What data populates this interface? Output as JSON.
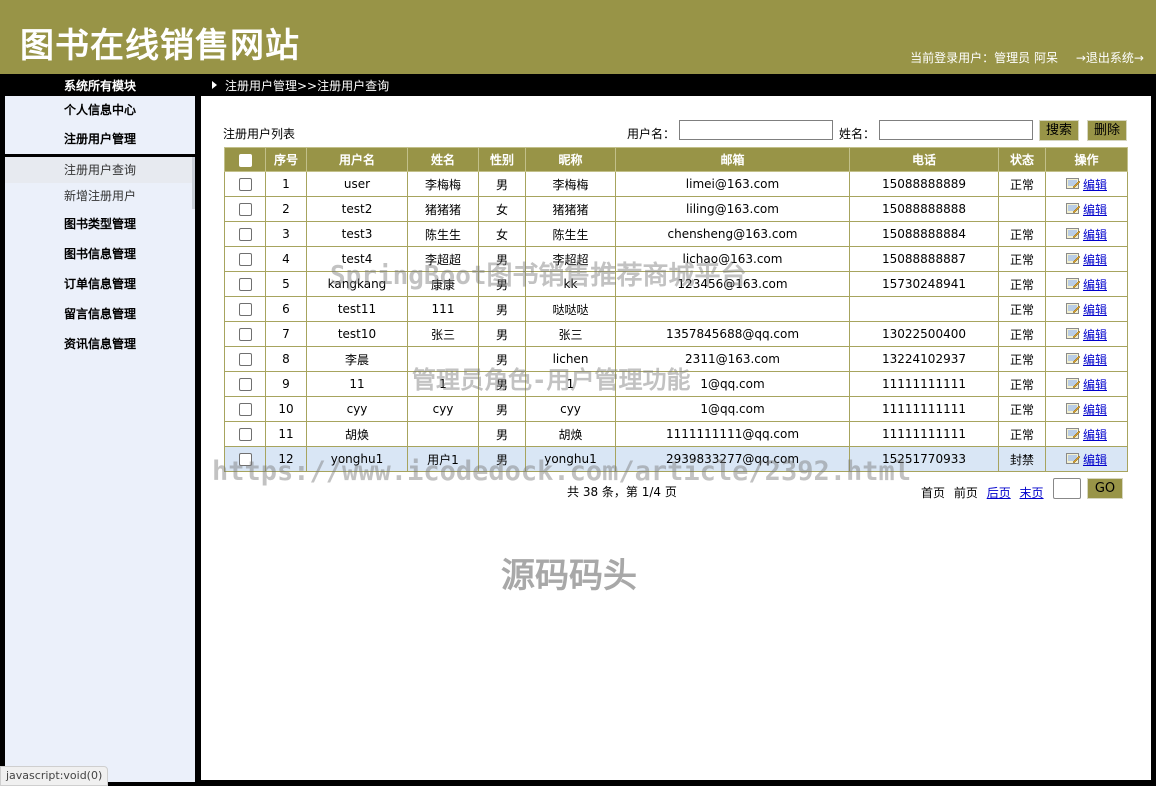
{
  "header": {
    "site_title": "图书在线销售网站",
    "user_info": "当前登录用户：管理员 阿呆",
    "logout": "→退出系统→"
  },
  "strip": {
    "module_title": "系统所有模块",
    "breadcrumb": "注册用户管理>>注册用户查询"
  },
  "sidebar": {
    "personal_center": "个人信息中心",
    "user_mgmt": "注册用户管理",
    "sub_items": [
      "注册用户查询",
      "新增注册用户"
    ],
    "others": [
      "图书类型管理",
      "图书信息管理",
      "订单信息管理",
      "留言信息管理",
      "资讯信息管理"
    ]
  },
  "toolbar": {
    "list_title": "注册用户列表",
    "username_label": "用户名：",
    "username_value": "",
    "name_label": "姓名：",
    "name_value": "",
    "search_label": "搜索",
    "delete_label": "删除"
  },
  "table": {
    "columns": [
      "序号",
      "用户名",
      "姓名",
      "性别",
      "昵称",
      "邮箱",
      "电话",
      "状态",
      "操作"
    ],
    "edit_label": "编辑",
    "rows": [
      {
        "no": "1",
        "username": "user",
        "name": "李梅梅",
        "gender": "男",
        "nickname": "李梅梅",
        "email": "limei@163.com",
        "phone": "15088888889",
        "status": "正常"
      },
      {
        "no": "2",
        "username": "test2",
        "name": "猪猪猪",
        "gender": "女",
        "nickname": "猪猪猪",
        "email": "liling@163.com",
        "phone": "15088888888",
        "status": ""
      },
      {
        "no": "3",
        "username": "test3",
        "name": "陈生生",
        "gender": "女",
        "nickname": "陈生生",
        "email": "chensheng@163.com",
        "phone": "15088888884",
        "status": "正常"
      },
      {
        "no": "4",
        "username": "test4",
        "name": "李超超",
        "gender": "男",
        "nickname": "李超超",
        "email": "lichao@163.com",
        "phone": "15088888887",
        "status": "正常"
      },
      {
        "no": "5",
        "username": "kangkang",
        "name": "康康",
        "gender": "男",
        "nickname": "kk",
        "email": "123456@163.com",
        "phone": "15730248941",
        "status": "正常"
      },
      {
        "no": "6",
        "username": "test11",
        "name": "111",
        "gender": "男",
        "nickname": "哒哒哒",
        "email": "",
        "phone": "",
        "status": "正常"
      },
      {
        "no": "7",
        "username": "test10",
        "name": "张三",
        "gender": "男",
        "nickname": "张三",
        "email": "1357845688@qq.com",
        "phone": "13022500400",
        "status": "正常"
      },
      {
        "no": "8",
        "username": "李晨",
        "name": "",
        "gender": "男",
        "nickname": "lichen",
        "email": "2311@163.com",
        "phone": "13224102937",
        "status": "正常"
      },
      {
        "no": "9",
        "username": "11",
        "name": "1",
        "gender": "男",
        "nickname": "1",
        "email": "1@qq.com",
        "phone": "11111111111",
        "status": "正常"
      },
      {
        "no": "10",
        "username": "cyy",
        "name": "cyy",
        "gender": "男",
        "nickname": "cyy",
        "email": "1@qq.com",
        "phone": "11111111111",
        "status": "正常"
      },
      {
        "no": "11",
        "username": "胡焕",
        "name": "",
        "gender": "男",
        "nickname": "胡焕",
        "email": "1111111111@qq.com",
        "phone": "11111111111",
        "status": "正常"
      },
      {
        "no": "12",
        "username": "yonghu1",
        "name": "用户1",
        "gender": "男",
        "nickname": "yonghu1",
        "email": "2939833277@qq.com",
        "phone": "15251770933",
        "status": "封禁"
      }
    ]
  },
  "pager": {
    "info": "共 38 条，第 1/4 页",
    "first": "首页",
    "prev": "前页",
    "next": "后页",
    "last": "末页",
    "go_label": "GO",
    "page_value": ""
  },
  "status_bar": "javascript:void(0)",
  "watermarks": {
    "line1": "SpringBoot图书销售推荐商城平台",
    "line2": "管理员角色-用户管理功能",
    "line3": "https://www.icodedock.com/article/2392.html",
    "line4": "源码码头"
  },
  "colors": {
    "header_bg": "#989447",
    "sidebar_bg": "#ebf0fa",
    "highlight_row": "#d9e6f5",
    "link": "#0000cc"
  },
  "icons": {
    "edit": "edit-icon",
    "nav_arrow": "arrow-right-icon"
  }
}
